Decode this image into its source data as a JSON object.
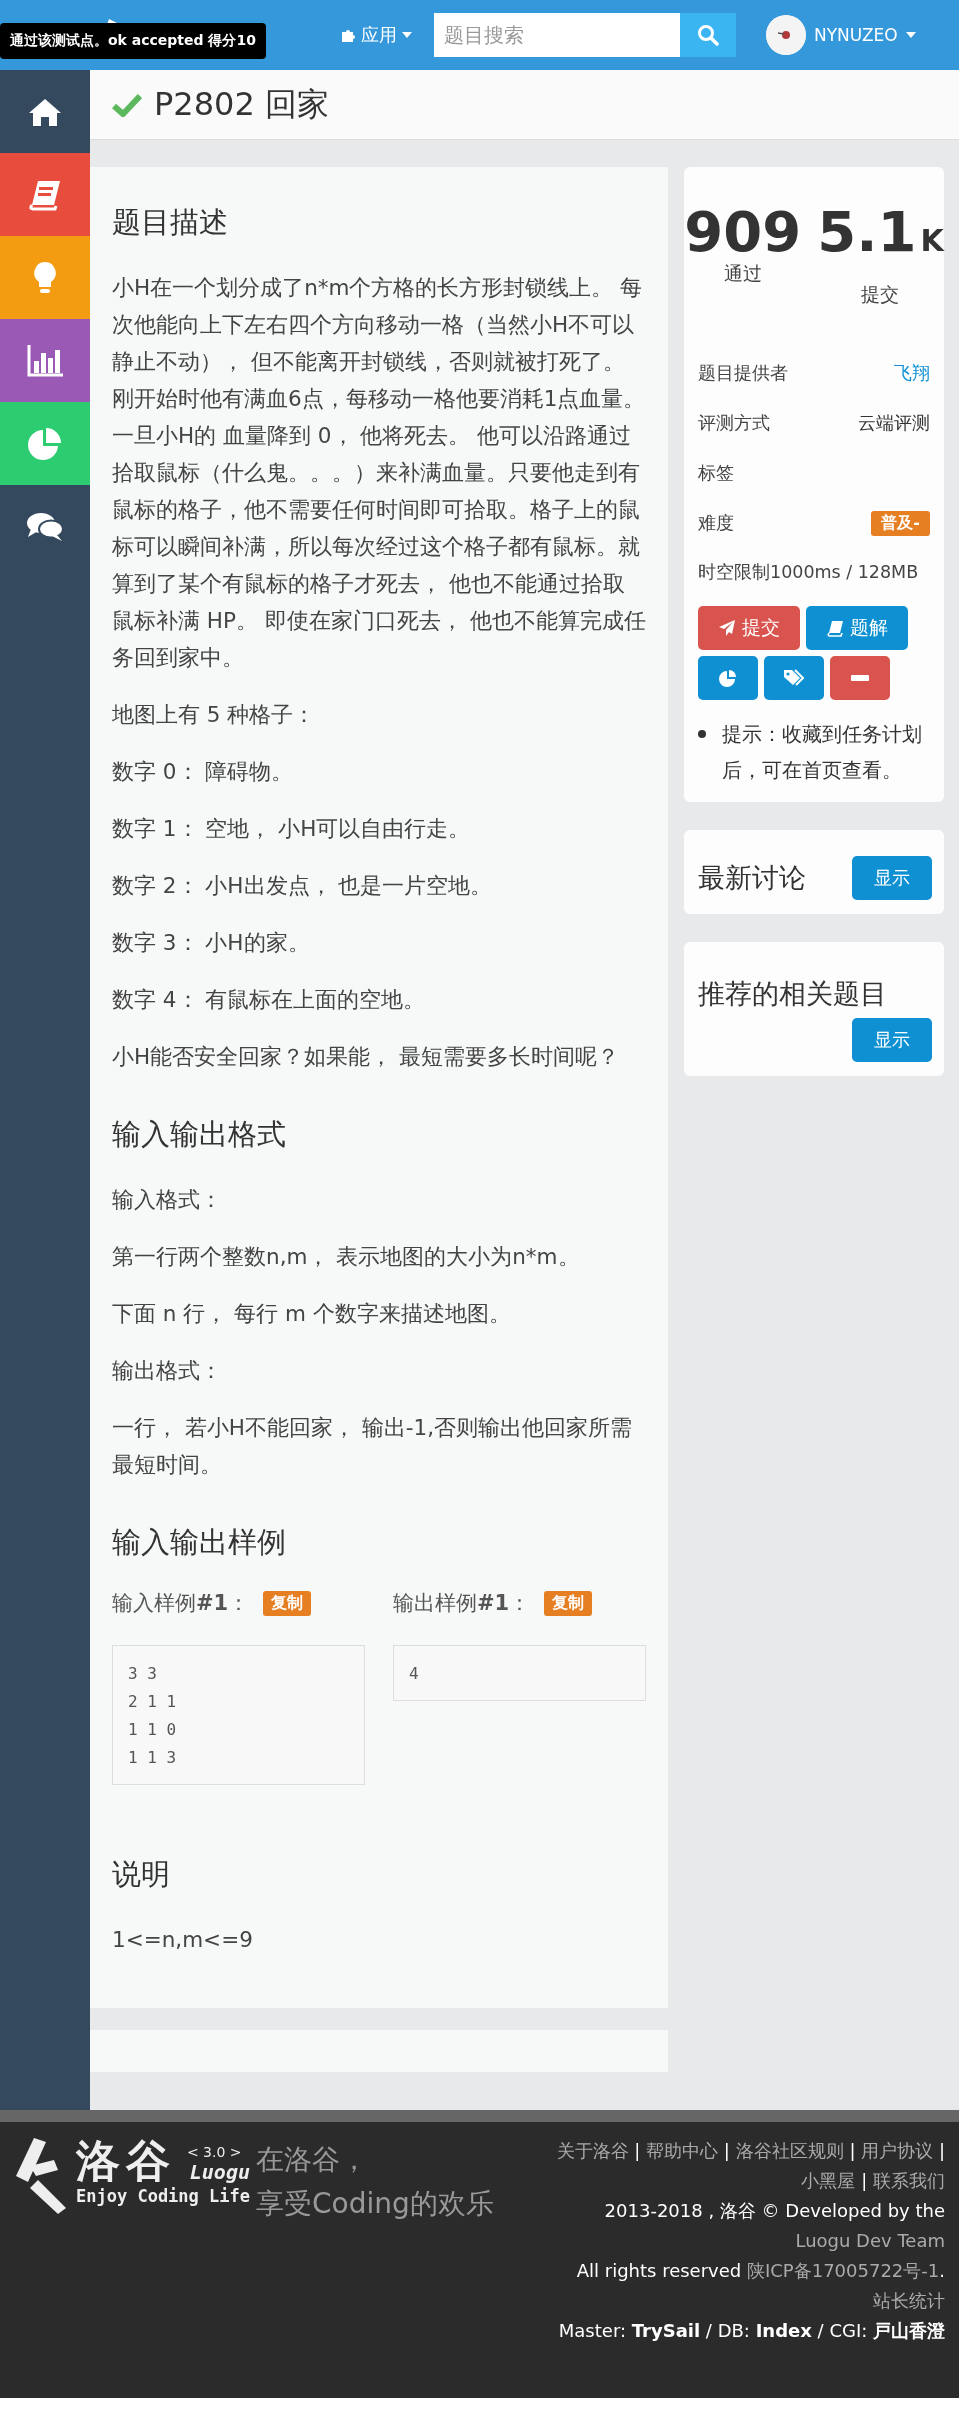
{
  "topbar": {
    "tooltip": "通过该测试点。ok accepted 得分10",
    "apps_menu": "应用",
    "search": {
      "placeholder": "题目搜索"
    },
    "user": "NYNUZEO"
  },
  "sidebar": {
    "items": [
      {
        "color": "#34495e"
      },
      {
        "color": "#e74c3c"
      },
      {
        "color": "#f39c12"
      },
      {
        "color": "#9b59b6"
      },
      {
        "color": "#2ecc71"
      },
      {
        "color": "#34495e"
      }
    ]
  },
  "problem": {
    "solved": true,
    "title": "P2802 回家"
  },
  "description": {
    "heading": "题目描述",
    "paragraphs": [
      "小H在一个划分成了n*m个方格的长方形封锁线上。 每次他能向上下左右四个方向移动一格（当然小H不可以静止不动）， 但不能离开封锁线，否则就被打死了。刚开始时他有满血6点，每移动一格他要消耗1点血量。一旦小H的 血量降到 0， 他将死去。 他可以沿路通过拾取鼠标（什么鬼。。。）来补满血量。只要他走到有鼠标的格子，他不需要任何时间即可拾取。格子上的鼠标可以瞬间补满，所以每次经过这个格子都有鼠标。就算到了某个有鼠标的格子才死去， 他也不能通过拾取鼠标补满 HP。 即使在家门口死去， 他也不能算完成任务回到家中。",
      "地图上有 5 种格子：",
      "数字 0： 障碍物。",
      "数字 1： 空地， 小H可以自由行走。",
      "数字 2： 小H出发点， 也是一片空地。",
      "数字 3： 小H的家。",
      "数字 4： 有鼠标在上面的空地。",
      "小H能否安全回家？如果能， 最短需要多长时间呢？"
    ]
  },
  "io_format": {
    "heading": "输入输出格式",
    "paragraphs": [
      "输入格式：",
      "第一行两个整数n,m， 表示地图的大小为n*m。",
      "下面 n 行， 每行 m 个数字来描述地图。",
      "输出格式：",
      "一行， 若小H不能回家， 输出-1,否则输出他回家所需最短时间。"
    ]
  },
  "samples": {
    "heading": "输入输出样例",
    "items": [
      {
        "label": "输入样例**#1**：",
        "copy": "复制",
        "lines": [
          "3 3",
          "2 1 1",
          "1 1 0",
          "1 1 3"
        ]
      },
      {
        "label": "输出样例**#1**：",
        "copy": "复制",
        "lines": [
          "4"
        ]
      }
    ]
  },
  "explanation": {
    "heading": "说明",
    "text": "1<=n,m<=9"
  },
  "stats": [
    {
      "value": "909",
      "label": "通过"
    },
    {
      "value": "5.1",
      "unit": "K",
      "label": "提交"
    }
  ],
  "info": [
    {
      "label": "题目提供者",
      "value": "飞翔",
      "kind": "link"
    },
    {
      "label": "评测方式",
      "value": "云端评测",
      "kind": "text"
    },
    {
      "label": "标签",
      "kind": "text"
    },
    {
      "label": "难度",
      "value": "普及-",
      "kind": "badge",
      "color": "#e67e22"
    }
  ],
  "limits": "时空限制1000ms / 128MB",
  "actions": [
    {
      "label": "提交",
      "color": "#d9534f"
    },
    {
      "label": "题解",
      "color": "#0e90d2"
    },
    {
      "color": "#0e90d2"
    },
    {
      "color": "#0e90d2"
    },
    {
      "color": "#d9534f"
    }
  ],
  "tip": "提示：收藏到任务计划后，可在首页查看。",
  "cards": [
    {
      "title": "最新讨论",
      "button": "显示"
    },
    {
      "title": "推荐的相关题目",
      "button": "显示"
    }
  ],
  "footer": {
    "logo": "洛谷",
    "version": "< 3.0 >",
    "brand": "Luogu",
    "motto": "Enjoy Coding Life",
    "slogan": [
      "在洛谷，",
      "享受Coding的欢乐"
    ],
    "separator": "|",
    "links": [
      "关于洛谷",
      "帮助中心",
      "洛谷社区规则",
      "用户协议",
      "小黑屋",
      "联系我们"
    ],
    "copyright": "2013-2018 , 洛谷 © Developed by the",
    "team": "Luogu Dev Team",
    "rights": "All rights reserved",
    "icp": "陕ICP备17005722号-1",
    "period": ".",
    "stats_link": "站长统计",
    "servers": "Master: **TrySail** / DB: **Index** / CGI: **戸山香澄**"
  }
}
